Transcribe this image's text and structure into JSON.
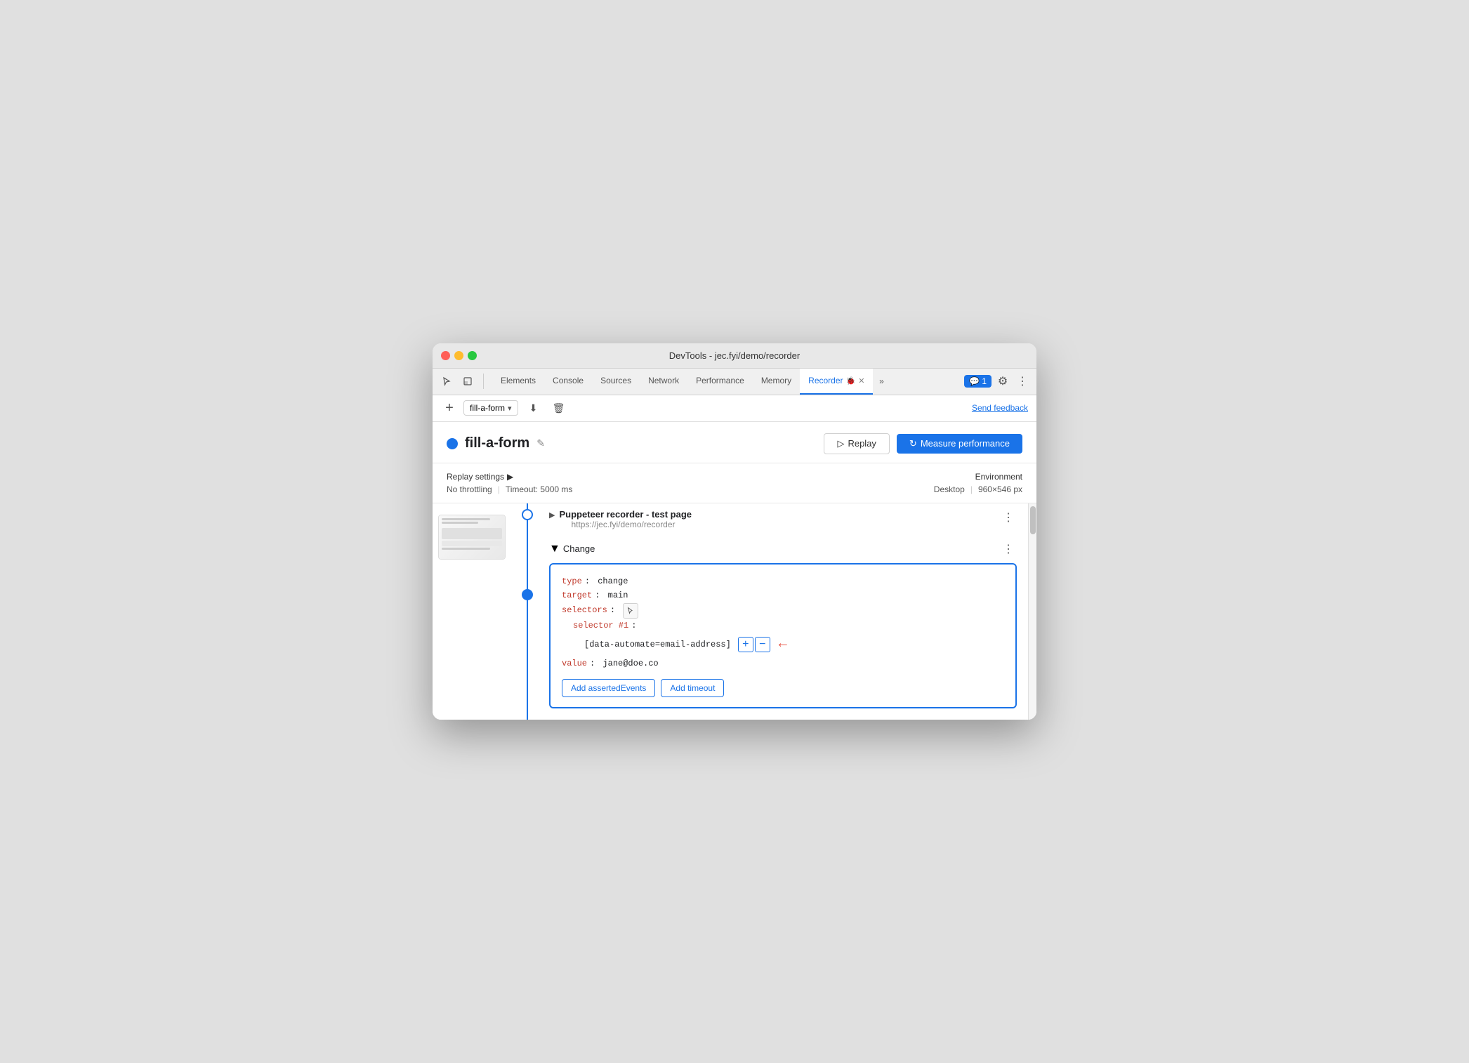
{
  "window": {
    "title": "DevTools - jec.fyi/demo/recorder"
  },
  "tabs": [
    {
      "label": "Elements",
      "active": false
    },
    {
      "label": "Console",
      "active": false
    },
    {
      "label": "Sources",
      "active": false
    },
    {
      "label": "Network",
      "active": false
    },
    {
      "label": "Performance",
      "active": false
    },
    {
      "label": "Memory",
      "active": false
    },
    {
      "label": "Recorder",
      "active": true
    },
    {
      "label": "✕",
      "active": false
    }
  ],
  "toolbar": {
    "add_label": "+",
    "recording_name": "fill-a-form",
    "dropdown_arrow": "▾",
    "download_icon": "⬇",
    "delete_icon": "🗑",
    "send_feedback_label": "Send feedback"
  },
  "recording": {
    "dot_color": "#1a73e8",
    "title": "fill-a-form",
    "edit_icon": "✎",
    "replay_label": "Replay",
    "measure_label": "Measure performance"
  },
  "replay_settings": {
    "section_label": "Replay settings",
    "expand_icon": "▶",
    "throttling_label": "No throttling",
    "timeout_label": "Timeout: 5000 ms"
  },
  "environment": {
    "section_label": "Environment",
    "device_label": "Desktop",
    "size_label": "960×546 px"
  },
  "step1": {
    "title": "Puppeteer recorder - test page",
    "url": "https://jec.fyi/demo/recorder",
    "expand_icon": "▶"
  },
  "step2": {
    "title": "Change",
    "expand_icon": "▼",
    "code": {
      "type_key": "type",
      "type_value": "change",
      "target_key": "target",
      "target_value": "main",
      "selectors_key": "selectors",
      "selector_label": "selector #1",
      "selector_value": "[data-automate=email-address]",
      "value_key": "value",
      "value_value": "jane@doe.co"
    },
    "add_asserted_label": "Add assertedEvents",
    "add_timeout_label": "Add timeout"
  }
}
